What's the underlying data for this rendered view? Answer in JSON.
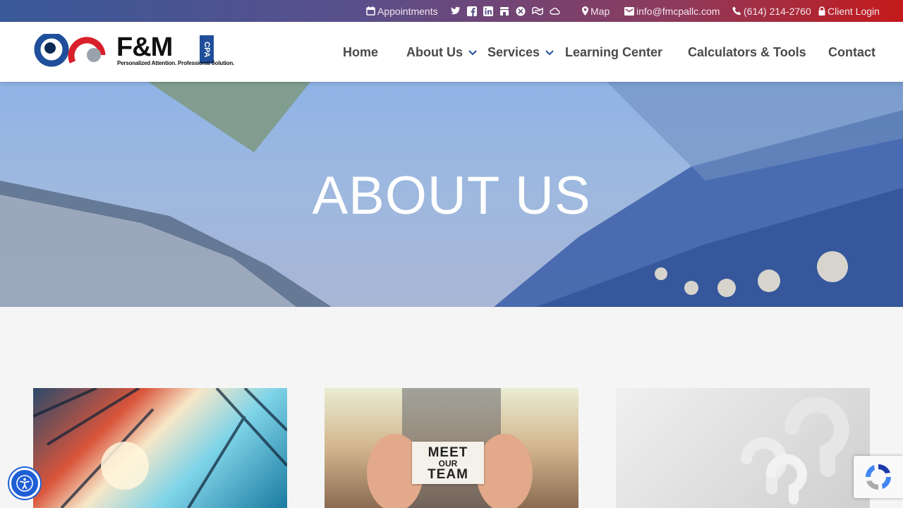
{
  "topbar": {
    "appointments": "Appointments",
    "social_icons": [
      "twitter-icon",
      "facebook-icon",
      "linkedin-icon",
      "google-business-icon",
      "yelp-icon",
      "directions-icon",
      "cloud-icon"
    ],
    "map": "Map",
    "email": "info@fmcpallc.com",
    "phone": "(614) 214-2760",
    "client_login": "Client Login"
  },
  "logo": {
    "name": "F&M",
    "badge": "CPA",
    "tagline": "Personalized Attention. Professional Solution."
  },
  "nav": {
    "items": [
      {
        "label": "Home",
        "has_dropdown": false
      },
      {
        "label": "About Us",
        "has_dropdown": true
      },
      {
        "label": "Services",
        "has_dropdown": true
      },
      {
        "label": "Learning Center",
        "has_dropdown": false
      },
      {
        "label": "Calculators & Tools",
        "has_dropdown": false
      },
      {
        "label": "Contact",
        "has_dropdown": false
      }
    ]
  },
  "hero": {
    "title": "ABOUT US"
  },
  "cards": [
    {
      "image": "building-sunlight-image"
    },
    {
      "image": "meet-our-team-image",
      "sign_line1": "MEET",
      "sign_line2": "OUR",
      "sign_line3": "TEAM"
    },
    {
      "image": "question-marks-image"
    }
  ],
  "colors": {
    "topbar_start": "#3a5a9a",
    "topbar_end": "#c41a1a",
    "nav_text": "#4a4a4a",
    "accent_blue": "#1f4f9a",
    "accent_red": "#d8202a"
  }
}
